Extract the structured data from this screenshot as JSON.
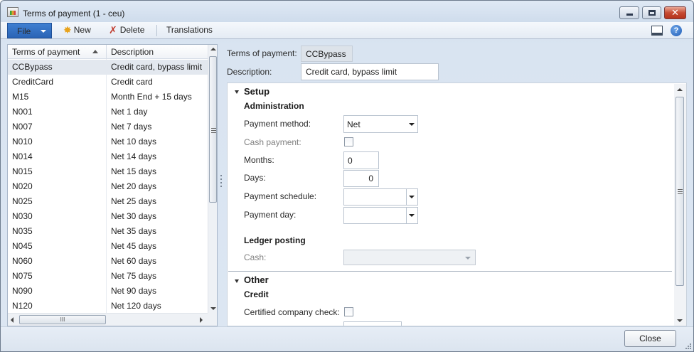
{
  "window": {
    "title": "Terms of payment (1 - ceu)",
    "close_glyph": "✕"
  },
  "toolbar": {
    "file_label": "File",
    "new_label": "New",
    "delete_label": "Delete",
    "translations_label": "Translations",
    "help_glyph": "?"
  },
  "grid": {
    "columns": [
      "Terms of payment",
      "Description"
    ],
    "hscroll_grip": "III",
    "rows": [
      {
        "term": "CCBypass",
        "description": "Credit card, bypass limit"
      },
      {
        "term": "CreditCard",
        "description": "Credit card"
      },
      {
        "term": "M15",
        "description": "Month End + 15 days"
      },
      {
        "term": "N001",
        "description": "Net 1 day"
      },
      {
        "term": "N007",
        "description": "Net 7 days"
      },
      {
        "term": "N010",
        "description": "Net 10 days"
      },
      {
        "term": "N014",
        "description": "Net 14 days"
      },
      {
        "term": "N015",
        "description": "Net 15 days"
      },
      {
        "term": "N020",
        "description": "Net 20 days"
      },
      {
        "term": "N025",
        "description": "Net 25 days"
      },
      {
        "term": "N030",
        "description": "Net 30 days"
      },
      {
        "term": "N035",
        "description": "Net 35 days"
      },
      {
        "term": "N045",
        "description": "Net 45 days"
      },
      {
        "term": "N060",
        "description": "Net 60 days"
      },
      {
        "term": "N075",
        "description": "Net 75 days"
      },
      {
        "term": "N090",
        "description": "Net 90 days"
      },
      {
        "term": "N120",
        "description": "Net 120 days"
      }
    ]
  },
  "header": {
    "terms_label": "Terms of payment:",
    "terms_value": "CCBypass",
    "description_label": "Description:",
    "description_value": "Credit card, bypass limit"
  },
  "setup": {
    "title": "Setup",
    "administration": {
      "title": "Administration",
      "payment_method_label": "Payment method:",
      "payment_method_value": "Net",
      "cash_payment_label": "Cash payment:",
      "months_label": "Months:",
      "months_value": "0",
      "days_label": "Days:",
      "days_value": "0",
      "payment_schedule_label": "Payment schedule:",
      "payment_day_label": "Payment day:"
    },
    "ledger": {
      "title": "Ledger posting",
      "cash_label": "Cash:"
    }
  },
  "other": {
    "title": "Other",
    "credit": {
      "title": "Credit",
      "certified_label": "Certified company check:"
    }
  },
  "footer": {
    "close_label": "Close"
  }
}
